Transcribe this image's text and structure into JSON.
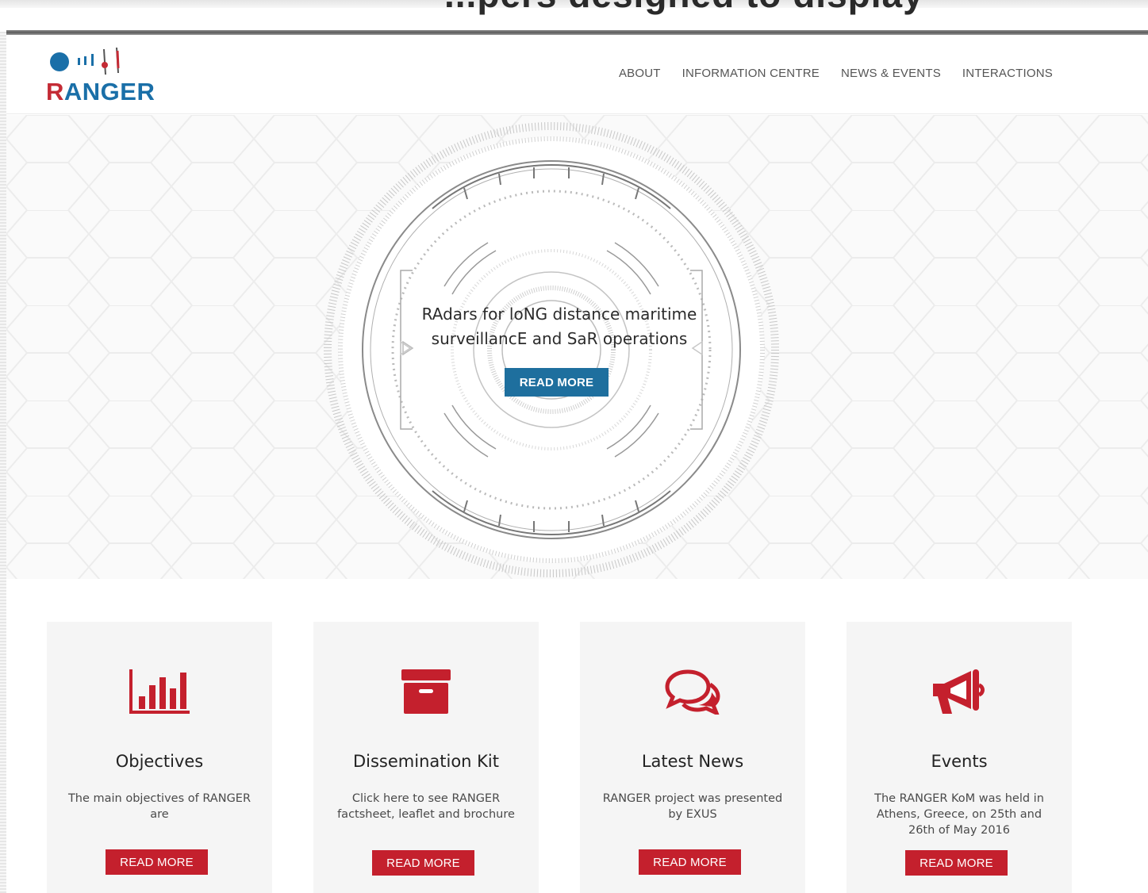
{
  "page": {
    "cut_off_heading": "...pers designed to display",
    "colors": {
      "brand_blue": "#1e6f9e",
      "brand_red": "#c4202d",
      "logo_blue": "#1a6fa8",
      "logo_red": "#c42b35"
    }
  },
  "header": {
    "logo": {
      "letter_r": "R",
      "rest": "ANGER",
      "icon": "radar-signal-logo-icon"
    },
    "nav": [
      {
        "label": "ABOUT"
      },
      {
        "label": "INFORMATION CENTRE"
      },
      {
        "label": "NEWS & EVENTS"
      },
      {
        "label": "INTERACTIONS"
      }
    ]
  },
  "hero": {
    "title_line1": "RAdars for loNG distance maritime",
    "title_line2": "surveillancE and SaR operations",
    "button": "READ MORE",
    "background": "radar-dial-graphic"
  },
  "cards": [
    {
      "icon": "bar-chart-icon",
      "title": "Objectives",
      "desc": "The main objectives of RANGER are",
      "button": "READ MORE"
    },
    {
      "icon": "archive-box-icon",
      "title": "Dissemination Kit",
      "desc": "Click here to see RANGER factsheet, leaflet and brochure",
      "button": "READ MORE"
    },
    {
      "icon": "chat-bubbles-icon",
      "title": "Latest News",
      "desc": "RANGER project was presented by EXUS",
      "button": "READ MORE"
    },
    {
      "icon": "megaphone-icon",
      "title": "Events",
      "desc": "The RANGER KoM was held in Athens, Greece, on 25th and 26th of May 2016",
      "button": "READ MORE"
    }
  ]
}
